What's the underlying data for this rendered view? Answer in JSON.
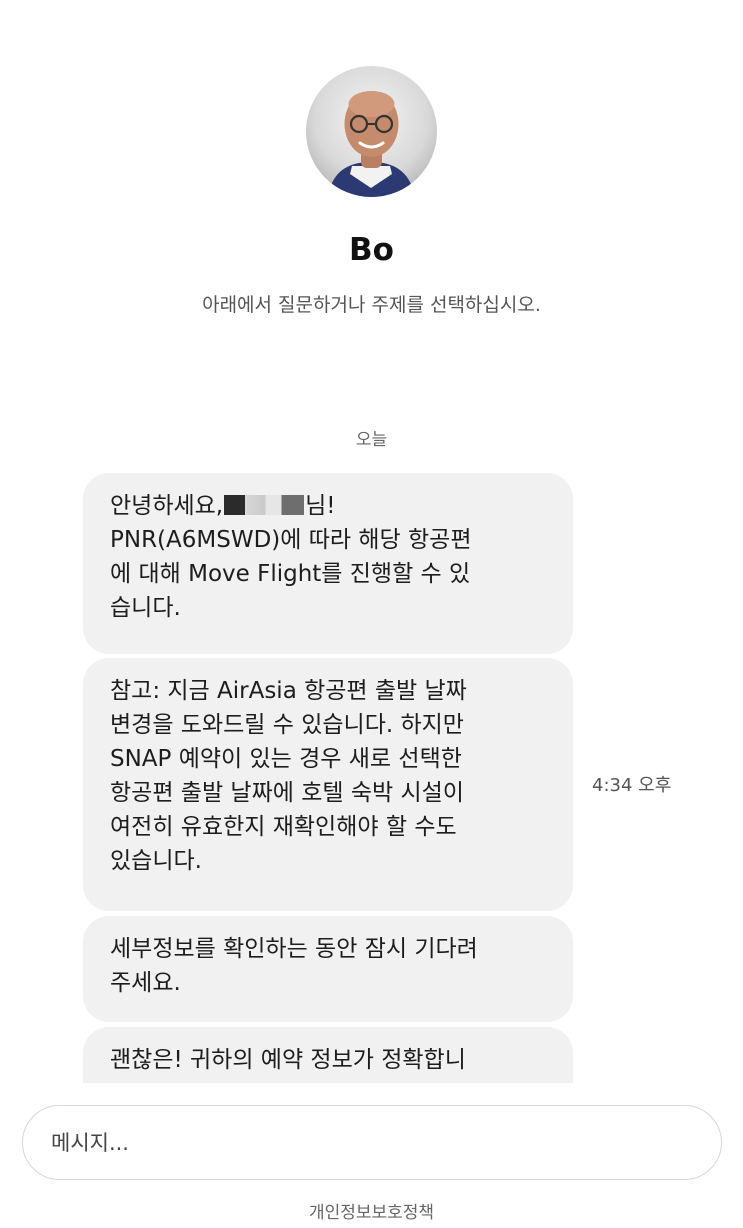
{
  "agent": {
    "name": "Bo",
    "subtitle": "아래에서 질문하거나 주제를 선택하십시오."
  },
  "chat": {
    "date_separator": "오늘",
    "timestamp": "4:34 오후",
    "messages": [
      {
        "greeting_before": "안녕하세요,",
        "greeting_after": "님!",
        "lines": [
          "PNR(A6MSWD)에 따라 해당 항공편",
          "에 대해 Move Flight를 진행할 수 있",
          "습니다."
        ]
      },
      {
        "lines": [
          "참고: 지금 AirAsia 항공편 출발 날짜",
          "변경을 도와드릴 수 있습니다. 하지만",
          "SNAP 예약이 있는 경우 새로 선택한",
          "항공편 출발 날짜에 호텔 숙박 시설이",
          "여전히 유효한지 재확인해야 할 수도",
          "있습니다."
        ]
      },
      {
        "lines": [
          "세부정보를 확인하는 동안 잠시 기다려",
          "주세요."
        ]
      },
      {
        "lines": [
          "괜찮은! 귀하의 예약 정보가 정확합니"
        ]
      }
    ]
  },
  "composer": {
    "placeholder": "메시지..."
  },
  "footer": {
    "privacy_link": "개인정보보호정책"
  },
  "colors": {
    "bubble_bg": "#f1f1f1",
    "page_bg": "#ffffff"
  }
}
